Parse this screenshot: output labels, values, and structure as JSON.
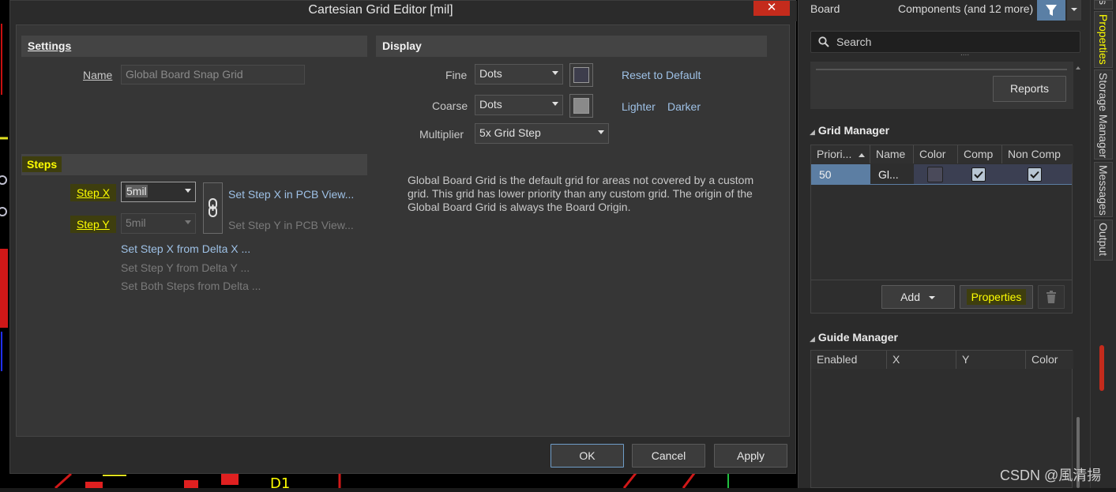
{
  "dialog": {
    "title": "Cartesian Grid Editor [mil]",
    "close_glyph": "✕",
    "settings": {
      "header": "Settings",
      "name_label": "Name",
      "name_value": "Global Board Snap Grid"
    },
    "steps": {
      "header": "Steps",
      "step_x_label": "Step X",
      "step_x_value": "5mil",
      "step_y_label": "Step Y",
      "step_y_value": "5mil",
      "set_x_pcb": "Set Step X in PCB View...",
      "set_y_pcb": "Set Step Y in PCB View...",
      "set_x_delta": "Set Step X from Delta X ...",
      "set_y_delta": "Set Step Y from Delta Y ...",
      "set_both_delta": "Set Both Steps from Delta ..."
    },
    "display": {
      "header": "Display",
      "fine_label": "Fine",
      "fine_value": "Dots",
      "fine_color": "#3d3d4c",
      "coarse_label": "Coarse",
      "coarse_value": "Dots",
      "coarse_color": "#8a8a8a",
      "multiplier_label": "Multiplier",
      "multiplier_value": "5x Grid Step",
      "reset": "Reset to Default",
      "lighter": "Lighter",
      "darker": "Darker",
      "description": "Global Board Grid is the default grid for areas not covered by a custom grid. This grid has lower priority than any custom grid. The origin of the Global Board Grid is always the Board Origin."
    },
    "buttons": {
      "ok": "OK",
      "cancel": "Cancel",
      "apply": "Apply"
    }
  },
  "panel": {
    "board_label": "Board",
    "components_label": "Components (and 12 more)",
    "search_placeholder": "Search",
    "ellipsis": "....",
    "reports_button": "Reports",
    "grid_manager": {
      "title": "Grid Manager",
      "columns": [
        "Priori...",
        "Name",
        "Color",
        "Comp",
        "Non Comp"
      ],
      "row": {
        "priority": "50",
        "name": "Gl...",
        "color": "#4a4a5a",
        "comp": true,
        "non_comp": true
      },
      "add_button": "Add",
      "properties_button": "Properties"
    },
    "guide_manager": {
      "title": "Guide Manager",
      "columns": [
        "Enabled",
        "X",
        "Y",
        "Color"
      ]
    }
  },
  "vertical_tabs": [
    "s",
    "Properties",
    "Storage Manager",
    "Messages",
    "Output"
  ],
  "pcb": {
    "designator": "D1"
  },
  "watermark": "CSDN @風清揚"
}
